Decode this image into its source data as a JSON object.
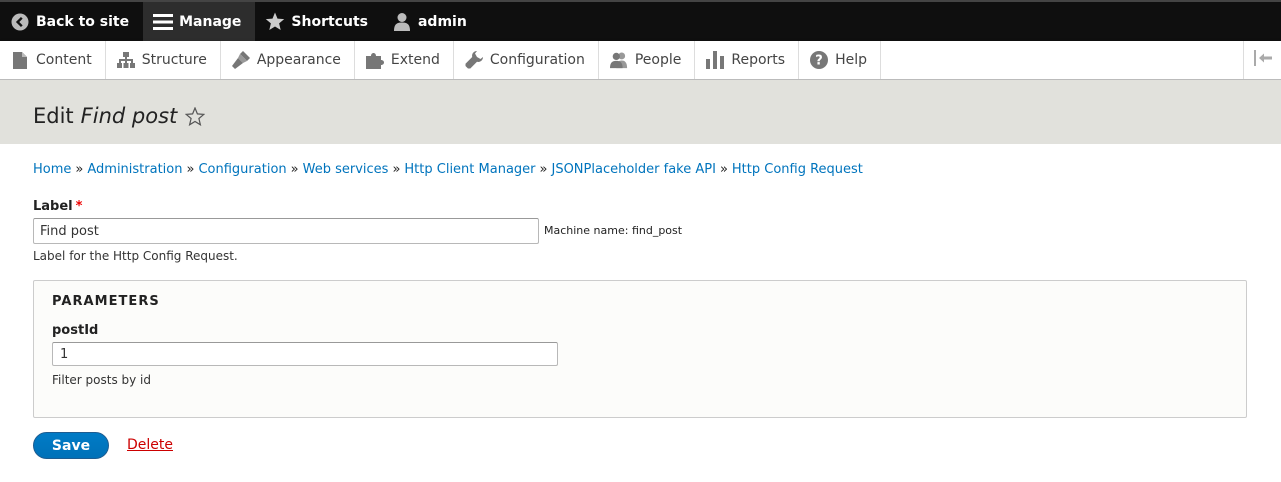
{
  "toolbar": {
    "back_label": "Back to site",
    "manage_label": "Manage",
    "shortcuts_label": "Shortcuts",
    "user_label": "admin"
  },
  "tray": {
    "items": [
      {
        "label": "Content",
        "icon": "file-icon"
      },
      {
        "label": "Structure",
        "icon": "sitemap-icon"
      },
      {
        "label": "Appearance",
        "icon": "paintbrush-icon"
      },
      {
        "label": "Extend",
        "icon": "puzzle-icon"
      },
      {
        "label": "Configuration",
        "icon": "wrench-icon"
      },
      {
        "label": "People",
        "icon": "people-icon"
      },
      {
        "label": "Reports",
        "icon": "bar-chart-icon"
      },
      {
        "label": "Help",
        "icon": "help-icon"
      }
    ]
  },
  "page": {
    "title_prefix": "Edit",
    "title_entity": "Find post"
  },
  "breadcrumb": [
    "Home",
    "Administration",
    "Configuration",
    "Web services",
    "Http Client Manager",
    "JSONPlaceholder fake API",
    "Http Config Request"
  ],
  "breadcrumb_separator": "»",
  "form": {
    "label_title": "Label",
    "required_marker": "*",
    "label_value": "Find post",
    "machine_name": "Machine name: find_post",
    "label_description": "Label for the Http Config Request.",
    "parameters_legend": "PARAMETERS",
    "postid_label": "postId",
    "postid_value": "1",
    "postid_description": "Filter posts by id",
    "save_label": "Save",
    "delete_label": "Delete"
  },
  "colors": {
    "toolbar_bg": "#0f0f0f",
    "link": "#0074bd",
    "primary_button": "#0071b8",
    "delete": "#c00000",
    "required": "#ee0000"
  }
}
